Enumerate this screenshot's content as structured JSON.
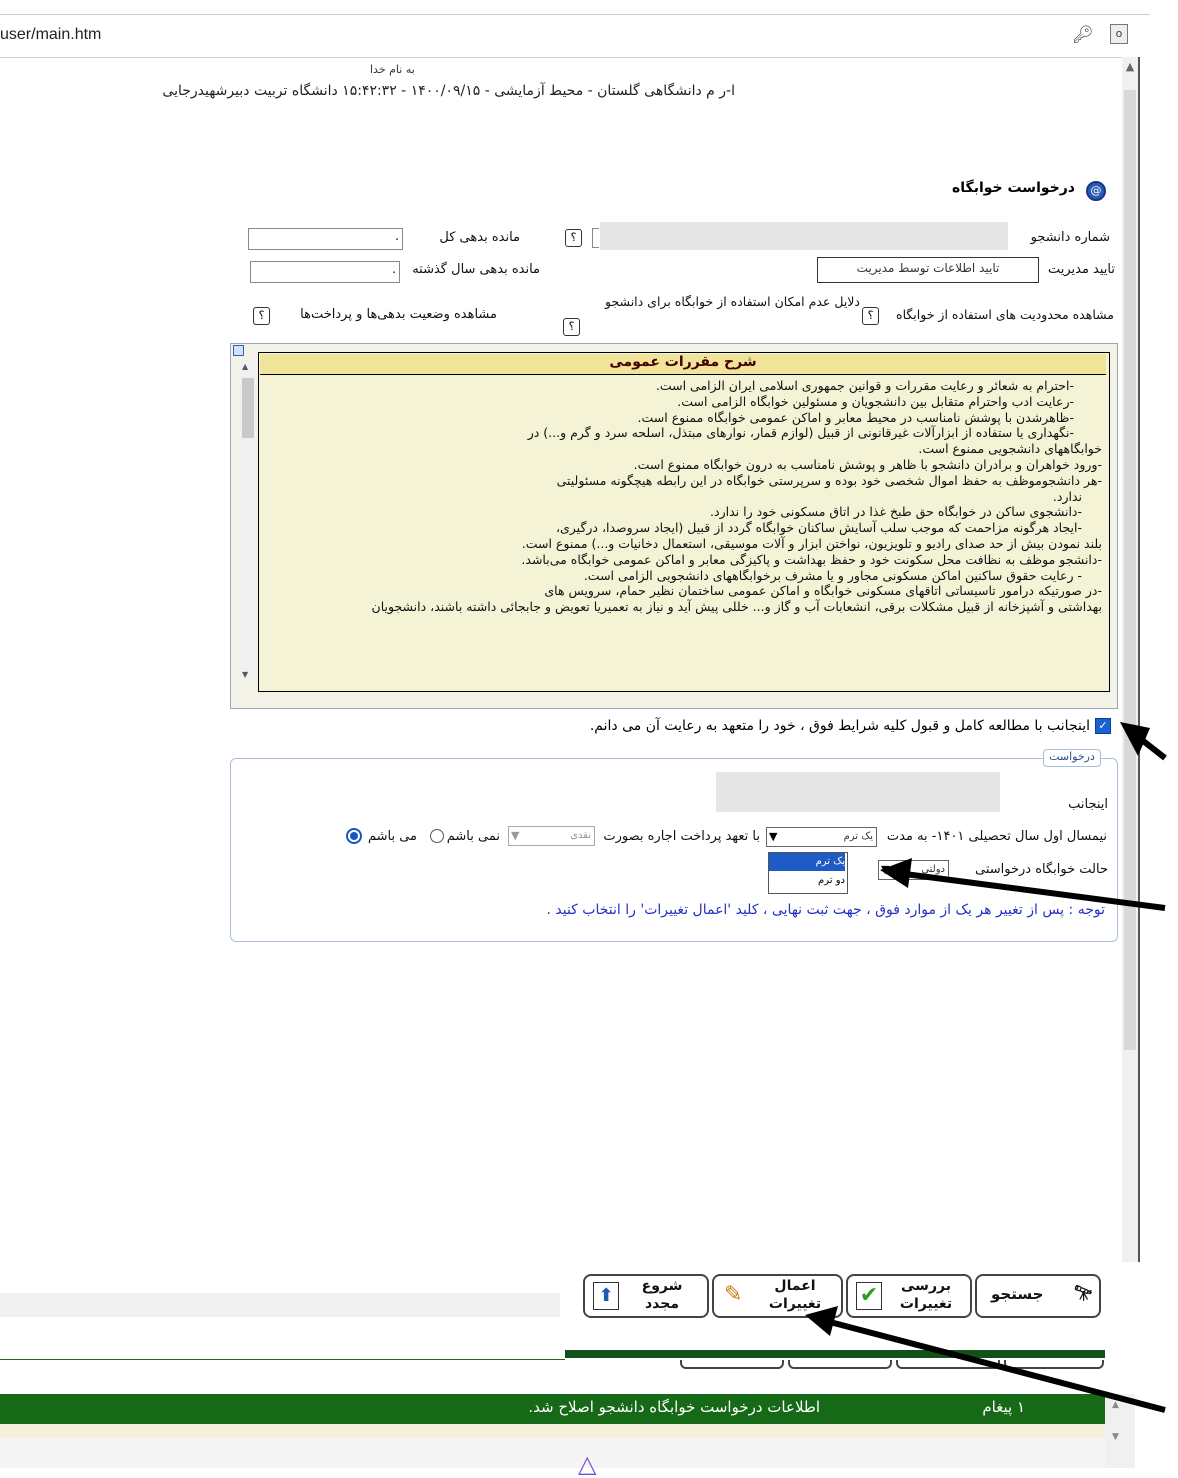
{
  "browser": {
    "url": "user/main.htm",
    "key_icon": "key-icon",
    "translate_icon": "translate-icon"
  },
  "header": {
    "bismillah": "به نام خدا",
    "line": "ا-ر  م دانشگاهی گلستان - محیط آزمایشی - ۱۴۰۰/۰۹/۱۵ - ۱۵:۴۲:۳۲  دانشگاه تربیت دبیرشهیدرجایی"
  },
  "page": {
    "title": "درخواست خوابگاه",
    "student_number_label": "شماره دانشجو",
    "total_debt_label": "مانده بدهی کل",
    "total_debt_value": ".",
    "manager_approval_label": "تایید مدیریت",
    "manager_approval_value": "تایید اطلاعات توسط مدیریت",
    "last_year_debt_label": "مانده بدهی سال گذشته",
    "last_year_debt_value": ".",
    "restrictions_link": "مشاهده محدودیت های استفاده از خوابگاه",
    "reasons_link": "دلایل عدم امکان استفاده از خوابگاه برای دانشجو",
    "debts_link": "مشاهده وضعیت بدهی‌ها و پرداخت‌ها",
    "help_glyph": "؟"
  },
  "rules": {
    "heading": "شرح مقررات عمومی",
    "lines": [
      "-احترام به شعائر و رعایت مقررات و قوانین جمهوری اسلامی ایران الزامی است.",
      "-رعایت ادب واحترام متقابل بین دانشجویان و مسئولین خوابگاه الزامی است.",
      "-ظاهرشدن با پوشش نامناسب در محیط معابر و اماکن عمومی خوابگاه ممنوع است.",
      "-نگهداری یا ستفاده از ابزارآلات غیرقانونی از قبیل (لوازم قمار، نوارهای مبتذل، اسلحه سرد و گرم و...) در",
      "خوابگاههای دانشجویی ممنوع است.",
      "-ورود خواهران و برادران دانشجو با ظاهر و پوشش نامناسب به درون خوابگاه ممنوع است.",
      "-هر دانشجوموظف به حفظ اموال شخصی خود بوده و سرپرستی خوابگاه در این رابطه هیچگونه مسئولیتی",
      "ندارد.",
      "-دانشجوی ساکن در خوابگاه حق طبخ غذا در اتاق مسکونی خود را ندارد.",
      "-ایجاد هرگونه مزاحمت که موجب سلب آسایش ساکنان خوابگاه گردد از قبیل (ایجاد سروصدا، درگیری،",
      "بلند نمودن بیش از حد صدای رادیو و تلویزیون، نواختن ابزار و آلات موسیقی، استعمال دخانیات و...) ممنوع است.",
      "-دانشجو موظف به نظافت محل سکونت خود و حفظ بهداشت و پاکیزگی معابر و اماکن عمومی خوابگاه می‌باشد.",
      "- رعایت حقوق ساکنین اماکن مسکونی مجاور و یا مشرف برخوابگاههای دانشجویی الزامی است.",
      "-در صورتیکه درامور تاسیساتی اتاقهای مسکونی خوابگاه و اماکن عمومی ساختمان نظیر حمام، سرویس های",
      "بهداشتی و آشپزخانه از قبیل مشکلات برقی، انشعابات آب و گاز و... خللی پیش آید و نیاز به تعمیریا تعویض و جابجائی داشته باشند، دانشجویان"
    ]
  },
  "agreement": {
    "checked": true,
    "text": "اینجانب با مطالعه کامل و قبول کلیه شرایط فوق ، خود را متعهد به رعایت آن می دانم."
  },
  "request": {
    "legend": "درخواست",
    "i_label": "اینجانب",
    "semester_text": "نیمسال اول سال تحصیلی ۱۴۰۱- به مدت",
    "duration_selected": "یک ترم",
    "duration_options": [
      "یک ترم",
      "دو ترم"
    ],
    "payment_text": "با تعهد پرداخت اجاره بصورت",
    "payment_selected": "نقدی",
    "not_am": "نمی باشم",
    "am": "می باشم",
    "dorm_state_label": "حالت خوابگاه درخواستی",
    "dorm_state_selected": "دولتی",
    "note": "توجه : پس از تغییر هر یک از موارد فوق ، جهت ثبت نهایی ، کلید 'اعمال تغییرات' را انتخاب کنید ."
  },
  "toolbar": {
    "search": "جستجو",
    "review": "بررسی تغییرات",
    "apply": "اعمال تغییرات",
    "restart": "شروع مجدد"
  },
  "message": {
    "count": "۱ پیغام",
    "text": "اطلاعات درخواست خوابگاه دانشجو اصلاح شد."
  },
  "colors": {
    "rules_header": "#f0e39a",
    "rules_body": "#f5f3d6",
    "message_bar": "#166a17",
    "note_text": "#2431c4",
    "checkbox": "#1a62d1"
  }
}
